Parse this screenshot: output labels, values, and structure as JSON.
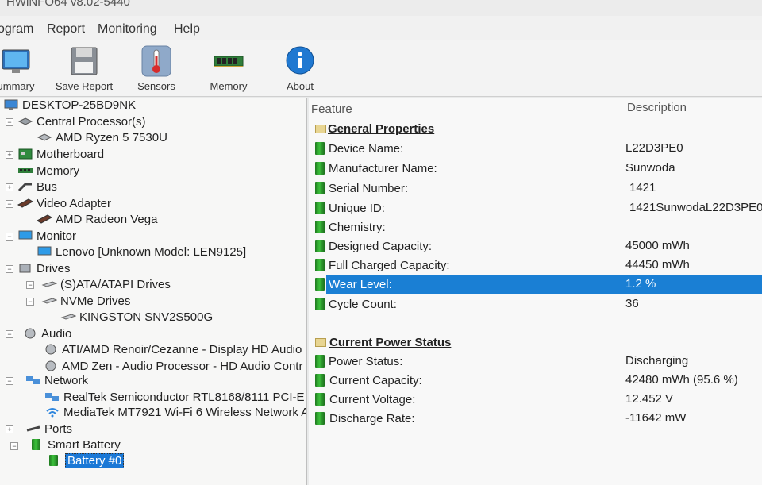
{
  "window": {
    "title": "HWiNFO64 v8.02-5440"
  },
  "menu": [
    "ogram",
    "Report",
    "Monitoring",
    "Help"
  ],
  "toolbar": {
    "buttons": [
      {
        "label": "ummary",
        "icon": "monitor-icon"
      },
      {
        "label": "Save Report",
        "icon": "floppy-disk-icon"
      },
      {
        "label": "Sensors",
        "icon": "thermometer-icon"
      },
      {
        "label": "Memory",
        "icon": "memory-module-icon"
      },
      {
        "label": "About",
        "icon": "info-icon"
      }
    ]
  },
  "tree": {
    "items": [
      {
        "label": "DESKTOP-25BD9NK",
        "icon": "computer-icon"
      },
      {
        "label": "Central Processor(s)",
        "icon": "cpu-icon"
      },
      {
        "label": "AMD Ryzen 5 7530U",
        "icon": "cpu-chip-icon"
      },
      {
        "label": "Motherboard",
        "icon": "motherboard-icon"
      },
      {
        "label": "Memory",
        "icon": "memory-icon"
      },
      {
        "label": "Bus",
        "icon": "bus-icon"
      },
      {
        "label": "Video Adapter",
        "icon": "video-card-icon"
      },
      {
        "label": "AMD Radeon Vega",
        "icon": "gpu-icon"
      },
      {
        "label": "Monitor",
        "icon": "monitor-icon"
      },
      {
        "label": "Lenovo [Unknown Model: LEN9125]",
        "icon": "monitor-icon"
      },
      {
        "label": "Drives",
        "icon": "drives-icon"
      },
      {
        "label": "(S)ATA/ATAPI Drives",
        "icon": "drive-icon"
      },
      {
        "label": "NVMe Drives",
        "icon": "drive-icon"
      },
      {
        "label": "KINGSTON SNV2S500G",
        "icon": "drive-icon"
      },
      {
        "label": "Audio",
        "icon": "speaker-icon"
      },
      {
        "label": "ATI/AMD Renoir/Cezanne - Display HD Audio",
        "icon": "speaker-icon"
      },
      {
        "label": "AMD Zen - Audio Processor - HD Audio Contr",
        "icon": "speaker-icon"
      },
      {
        "label": "Network",
        "icon": "network-icon"
      },
      {
        "label": "RealTek Semiconductor RTL8168/8111 PCI-E",
        "icon": "network-icon"
      },
      {
        "label": "MediaTek MT7921 Wi-Fi 6 Wireless Network A",
        "icon": "wifi-icon"
      },
      {
        "label": "Ports",
        "icon": "port-icon"
      },
      {
        "label": "Smart Battery",
        "icon": "battery-icon"
      },
      {
        "label": "Battery #0",
        "icon": "battery-icon"
      }
    ]
  },
  "details": {
    "header_feature": "Feature",
    "header_description": "Description",
    "sections": [
      {
        "title": "General Properties",
        "rows": [
          {
            "feature": "Device Name:",
            "value": "L22D3PE0"
          },
          {
            "feature": "Manufacturer Name:",
            "value": "Sunwoda"
          },
          {
            "feature": "Serial Number:",
            "value": "1421"
          },
          {
            "feature": "Unique ID:",
            "value": "1421SunwodaL22D3PE0"
          },
          {
            "feature": "Chemistry:",
            "value": ""
          },
          {
            "feature": "Designed Capacity:",
            "value": "45000 mWh"
          },
          {
            "feature": "Full Charged Capacity:",
            "value": "44450 mWh"
          },
          {
            "feature": "Wear Level:",
            "value": "1.2 %"
          },
          {
            "feature": "Cycle Count:",
            "value": "36"
          }
        ]
      },
      {
        "title": "Current Power Status",
        "rows": [
          {
            "feature": "Power Status:",
            "value": "Discharging"
          },
          {
            "feature": "Current Capacity:",
            "value": "42480 mWh (95.6 %)"
          },
          {
            "feature": "Current Voltage:",
            "value": "12.452 V"
          },
          {
            "feature": "Discharge Rate:",
            "value": "-11642 mW"
          }
        ]
      }
    ]
  },
  "colors": {
    "selection": "#1a7fd4",
    "battery_green": "#2e9e2e"
  }
}
